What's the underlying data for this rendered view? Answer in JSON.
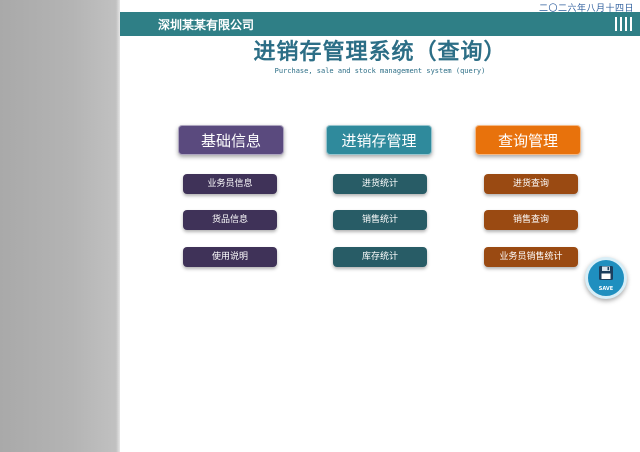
{
  "date_text": "二〇二六年八月十四日",
  "header": {
    "company": "深圳某某有限公司"
  },
  "title": {
    "main": "进销存管理系统（查询）",
    "sub": "Purchase, sale and stock management system (query)"
  },
  "sections": [
    {
      "heading": "基础信息",
      "items": [
        "业务员信息",
        "货品信息",
        "使用说明"
      ]
    },
    {
      "heading": "进销存管理",
      "items": [
        "进货统计",
        "销售统计",
        "库存统计"
      ]
    },
    {
      "heading": "查询管理",
      "items": [
        "进货查询",
        "销售查询",
        "业务员销售统计"
      ]
    }
  ],
  "save": {
    "label": "SAVE",
    "icon": "floppy-disk-icon"
  },
  "colors": {
    "header_bar": "#2f7f86",
    "title": "#2c6e86",
    "purple": "#5a4a7e",
    "teal": "#2f8a9c",
    "orange": "#e8720c"
  }
}
